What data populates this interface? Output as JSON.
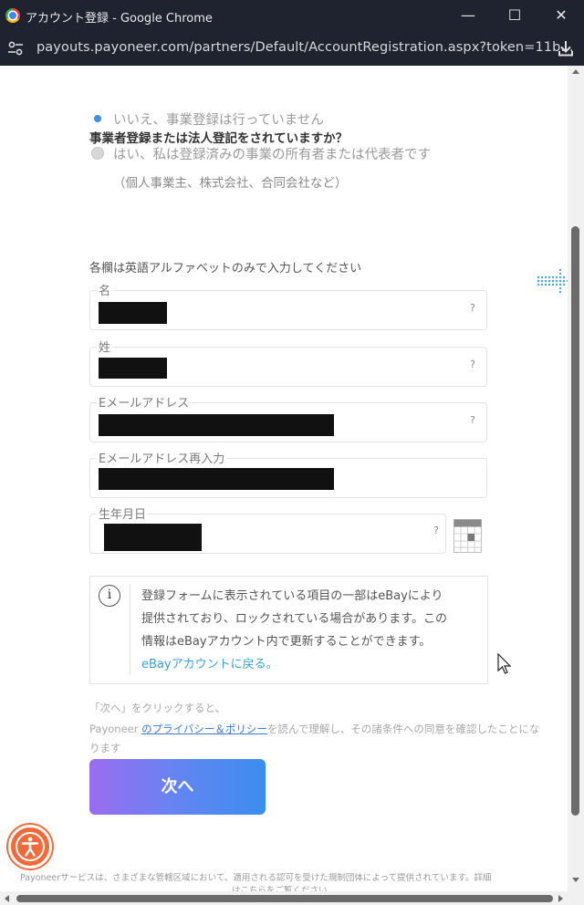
{
  "window": {
    "title": "アカウント登録 - Google Chrome",
    "minimize_glyph": "—",
    "maximize_glyph": "☐",
    "close_glyph": "✕"
  },
  "address_bar": {
    "url": "payouts.payoneer.com/partners/Default/AccountRegistration.aspx?token=11b..."
  },
  "form": {
    "question": "事業者登録または法人登記をされていますか？",
    "options": [
      {
        "label": "いいえ、事業登録は行っていません",
        "selected": true
      },
      {
        "label": "はい、私は登録済みの事業の所有者または代表者です",
        "sub": "（個人事業主、株式会社、合同会社など）",
        "selected": false
      }
    ],
    "instruction": "各欄は英語アルファベットのみで入力してください",
    "fields": {
      "first_name_label": "名",
      "last_name_label": "姓",
      "email_label": "Eメールアドレス",
      "email_confirm_label": "Eメールアドレス再入力",
      "birthdate_label": "生年月日"
    },
    "help_glyph": "?"
  },
  "notice": {
    "icon_glyph": "i",
    "line1": "登録フォームに表示されている項目の一部はeBayにより",
    "line2": "提供されており、ロックされている場合があります。この",
    "line3": "情報はeBayアカウント内で更新することができます。",
    "link": "eBayアカウントに戻る。"
  },
  "consent": {
    "line1": "「次へ」をクリックすると、",
    "prefix": "Payoneer ",
    "link": "のプライバシー＆ポリシー",
    "suffix": "を読んで理解し、その諸条件への同意を確認したことにな",
    "line3": "ります"
  },
  "next_button": "次へ",
  "footer": {
    "line1": "Payoneerサービスは、さまざまな管轄区域において、適用される認可を受けた規制団体によって提供されています。詳細",
    "line2": "はこちらをご覧ください"
  },
  "colors": {
    "accent_blue": "#3d8ee6",
    "link_blue": "#3aa0d8",
    "button_gradient_start": "#9b6df0",
    "button_gradient_end": "#3b8df0",
    "accessibility_orange": "#f06a3a"
  }
}
